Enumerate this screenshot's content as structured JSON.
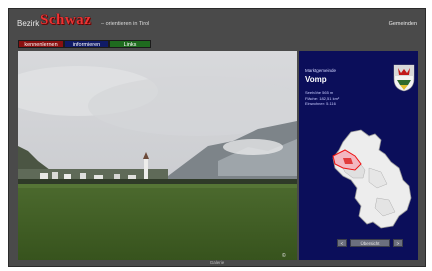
{
  "header": {
    "brand_prefix": "Bezirk",
    "brand_logo": "Schwaz",
    "tagline": "– orientieren in Tirol",
    "nav_link": "Gemeinden"
  },
  "tabs": [
    {
      "label": "kennenlernen",
      "color": "#8a1010"
    },
    {
      "label": "informieren",
      "color": "#101b66"
    },
    {
      "label": "Links",
      "color": "#1f6b1f"
    }
  ],
  "panel": {
    "town_label": "Marktgemeinde",
    "town_name": "Vomp",
    "facts": [
      "Seehöhe 565 m",
      "Fläche: 182,51 km²",
      "Einwohner: 5.116"
    ],
    "coat_icon": "coat-of-arms-icon",
    "map_icon": "district-map-icon",
    "prev_label": "<",
    "mid_label": "Übersicht",
    "next_label": ">"
  },
  "footer": {
    "text": "Galerie"
  },
  "photo": {
    "icon": "landscape-photo"
  },
  "colors": {
    "frame": "#4a4a4a",
    "panel": "#0b0e5a",
    "accent_red": "#e33"
  }
}
